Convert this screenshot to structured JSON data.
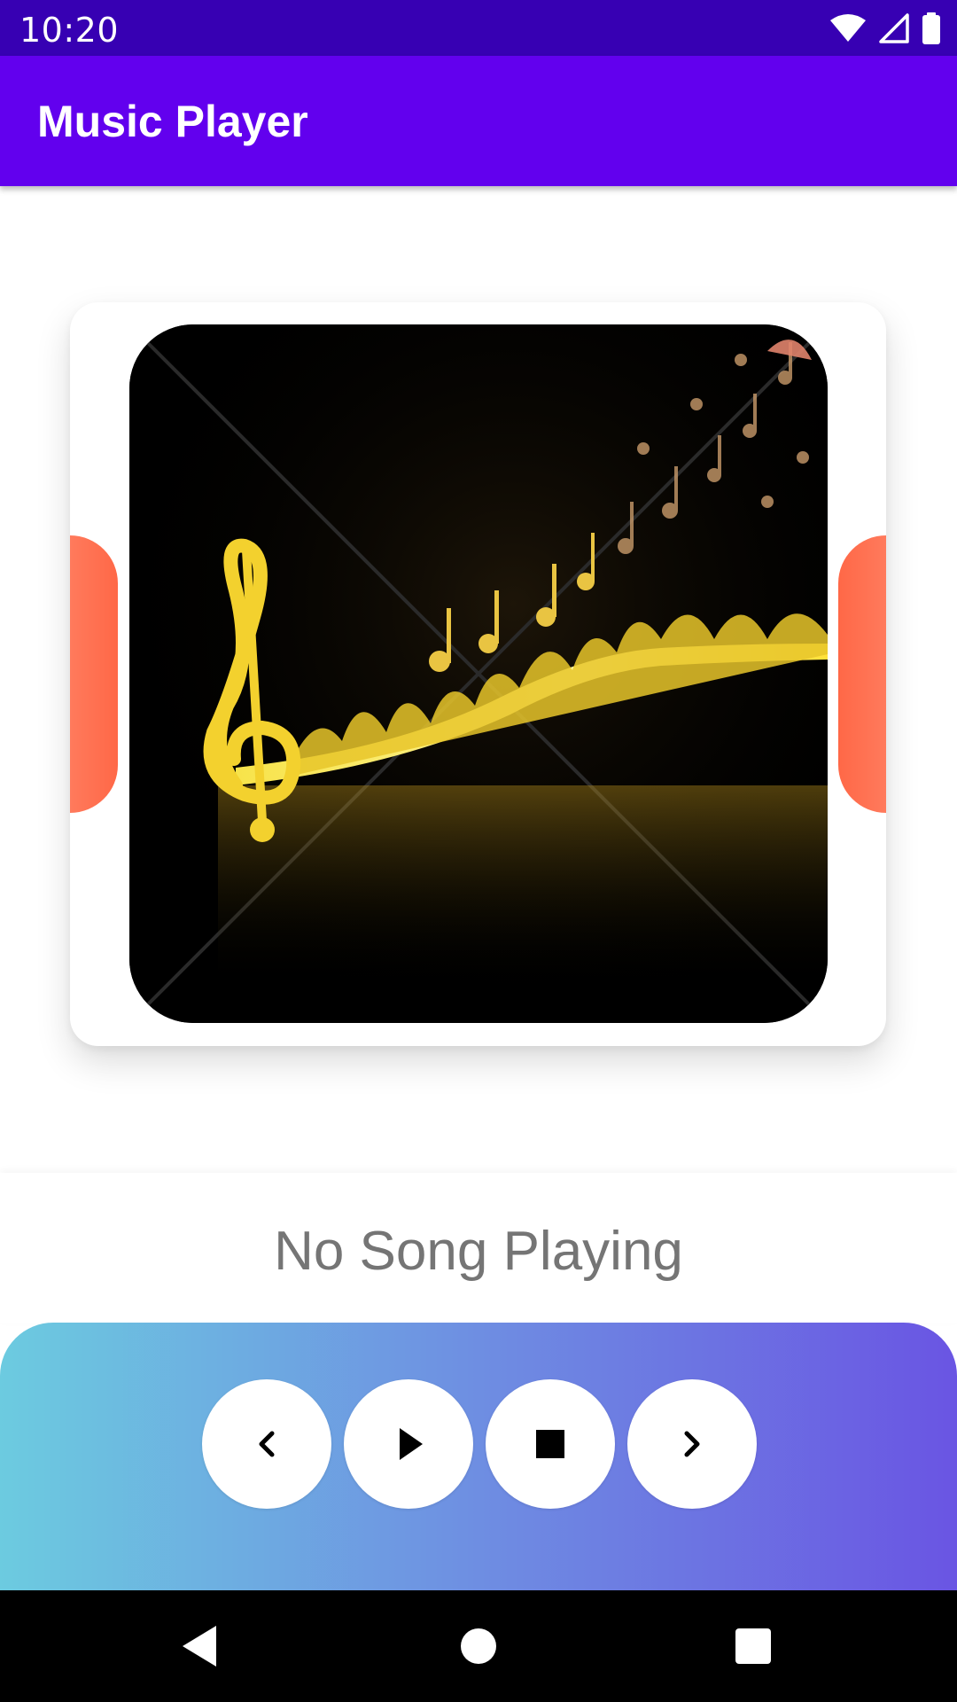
{
  "status_bar": {
    "time": "10:20",
    "icons": [
      "wifi-icon",
      "cell-signal-icon",
      "battery-icon"
    ]
  },
  "app_bar": {
    "title": "Music Player",
    "color": "#6200ee"
  },
  "album_art": {
    "description_icon": "music-notes-image"
  },
  "now_playing": {
    "text": "No Song Playing"
  },
  "controls": [
    {
      "name": "previous",
      "icon": "chevron-left-icon"
    },
    {
      "name": "play",
      "icon": "play-icon"
    },
    {
      "name": "stop",
      "icon": "stop-icon"
    },
    {
      "name": "next",
      "icon": "chevron-right-icon"
    }
  ],
  "nav_bar": {
    "buttons": [
      "back-icon",
      "home-icon",
      "recents-icon"
    ]
  },
  "colors": {
    "status_bar": "#3700b3",
    "side_tabs": "#ff6f4e",
    "panel_gradient_start": "#6ccbe0",
    "panel_gradient_end": "#6a55e3"
  }
}
